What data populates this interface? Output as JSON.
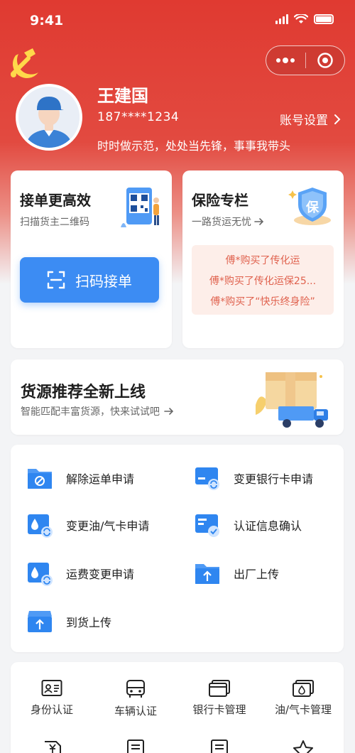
{
  "status": {
    "time": "9:41"
  },
  "profile": {
    "name": "王建国",
    "phone": "187****1234",
    "settings_label": "账号设置",
    "slogan": "时时做示范，处处当先锋，事事我带头"
  },
  "order_card": {
    "title": "接单更高效",
    "subtitle": "扫描货主二维码",
    "button_label": "扫码接单"
  },
  "insurance_card": {
    "title": "保险专栏",
    "subtitle": "一路货运无忧",
    "badge_text": "保",
    "purchases": [
      "傅*购买了传化运",
      "傅*购买了传化运保25...",
      "傅*购买了“快乐终身险”"
    ]
  },
  "cargo_banner": {
    "title": "货源推荐全新上线",
    "subtitle": "智能匹配丰富货源，快来试试吧"
  },
  "services": [
    {
      "label": "解除运单申请",
      "icon": "folder-cancel-icon"
    },
    {
      "label": "变更银行卡申请",
      "icon": "bank-card-change-icon"
    },
    {
      "label": "变更油/气卡申请",
      "icon": "fuel-card-change-icon"
    },
    {
      "label": "认证信息确认",
      "icon": "verify-card-icon"
    },
    {
      "label": "运费变更申请",
      "icon": "freight-change-icon"
    },
    {
      "label": "出厂上传",
      "icon": "upload-folder-icon"
    },
    {
      "label": "到货上传",
      "icon": "upload-box-icon"
    }
  ],
  "grid": [
    {
      "label": "身份认证",
      "icon": "id-card-icon"
    },
    {
      "label": "车辆认证",
      "icon": "vehicle-icon"
    },
    {
      "label": "银行卡管理",
      "icon": "bank-card-icon"
    },
    {
      "label": "油/气卡管理",
      "icon": "fuel-card-icon"
    }
  ],
  "colors": {
    "brand_red": "#e03a31",
    "accent_blue": "#3c8cf3",
    "insurance_red": "#e0624e"
  }
}
